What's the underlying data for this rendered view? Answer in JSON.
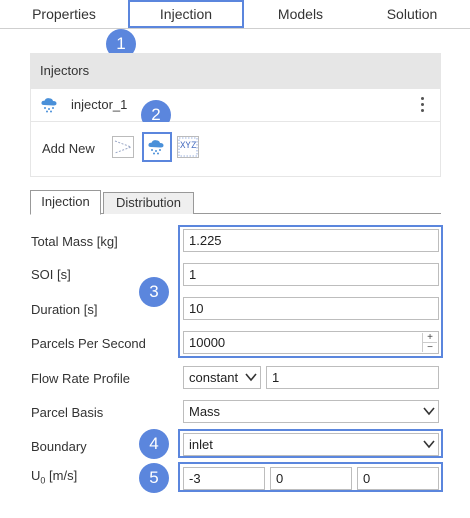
{
  "top_tabs": [
    {
      "label": "Properties"
    },
    {
      "label": "Injection"
    },
    {
      "label": "Models"
    },
    {
      "label": "Solution"
    }
  ],
  "callouts": [
    "1",
    "2",
    "3",
    "4",
    "5"
  ],
  "injectors": {
    "header": "Injectors",
    "items": [
      {
        "name": "injector_1",
        "icon": "spray-cloud-icon"
      }
    ],
    "add_new_label": "Add New",
    "add_buttons": [
      {
        "icon": "cone-injector-icon"
      },
      {
        "icon": "spray-cloud-icon"
      },
      {
        "icon": "xyz-point-icon",
        "text": "XYZ"
      }
    ]
  },
  "sub_tabs": [
    {
      "label": "Injection",
      "active": true
    },
    {
      "label": "Distribution",
      "active": false
    }
  ],
  "form": {
    "total_mass": {
      "label": "Total Mass [kg]",
      "value": "1.225"
    },
    "soi": {
      "label": "SOI [s]",
      "value": "1"
    },
    "duration": {
      "label": "Duration [s]",
      "value": "10"
    },
    "parcels_per_second": {
      "label": "Parcels Per Second",
      "value": "10000"
    },
    "flow_rate_profile": {
      "label": "Flow Rate Profile",
      "selected": "constant",
      "value": "1"
    },
    "parcel_basis": {
      "label": "Parcel Basis",
      "selected": "Mass"
    },
    "boundary": {
      "label": "Boundary",
      "selected": "inlet"
    },
    "u0": {
      "label_main": "U",
      "label_sub": "0",
      "label_unit": " [m/s]",
      "values": [
        "-3",
        "0",
        "0"
      ]
    }
  },
  "colors": {
    "highlight": "#5b86dd",
    "header_bg": "#e6e6e6"
  }
}
